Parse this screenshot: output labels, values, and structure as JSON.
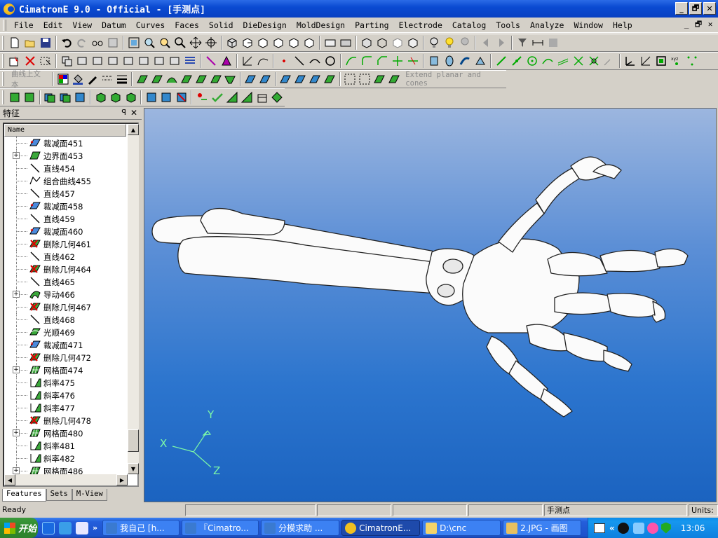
{
  "window": {
    "title": "CimatronE 9.0 - Official - [手测点]",
    "min": "_",
    "max": "🗗",
    "close": "✕"
  },
  "menu": [
    "File",
    "Edit",
    "View",
    "Datum",
    "Curves",
    "Faces",
    "Solid",
    "DieDesign",
    "MoldDesign",
    "Parting",
    "Electrode",
    "Catalog",
    "Tools",
    "Analyze",
    "Window",
    "Help"
  ],
  "toolbar3": {
    "disabled_text_1": "曲线上文本",
    "disabled_text_2": "Extend planar and cones"
  },
  "panel": {
    "title": "特征",
    "column": "Name",
    "items": [
      {
        "label": "裁减面451",
        "icon": "trim"
      },
      {
        "label": "边界面453",
        "icon": "boundary",
        "expand": "+"
      },
      {
        "label": "直线454",
        "icon": "line"
      },
      {
        "label": "组合曲线455",
        "icon": "composite"
      },
      {
        "label": "直线457",
        "icon": "line"
      },
      {
        "label": "裁减面458",
        "icon": "trim"
      },
      {
        "label": "直线459",
        "icon": "line"
      },
      {
        "label": "裁减面460",
        "icon": "trim"
      },
      {
        "label": "删除几何461",
        "icon": "delete"
      },
      {
        "label": "直线462",
        "icon": "line"
      },
      {
        "label": "删除几何464",
        "icon": "delete"
      },
      {
        "label": "直线465",
        "icon": "line"
      },
      {
        "label": "导动466",
        "icon": "sweep",
        "expand": "+"
      },
      {
        "label": "删除几何467",
        "icon": "delete"
      },
      {
        "label": "直线468",
        "icon": "line"
      },
      {
        "label": "光顺469",
        "icon": "smooth"
      },
      {
        "label": "裁减面471",
        "icon": "trim"
      },
      {
        "label": "删除几何472",
        "icon": "delete"
      },
      {
        "label": "网格面474",
        "icon": "mesh",
        "expand": "+"
      },
      {
        "label": "斜率475",
        "icon": "slope"
      },
      {
        "label": "斜率476",
        "icon": "slope"
      },
      {
        "label": "斜率477",
        "icon": "slope"
      },
      {
        "label": "删除几何478",
        "icon": "delete"
      },
      {
        "label": "网格面480",
        "icon": "mesh",
        "expand": "+"
      },
      {
        "label": "斜率481",
        "icon": "slope"
      },
      {
        "label": "斜率482",
        "icon": "slope"
      },
      {
        "label": "网格面486",
        "icon": "mesh",
        "expand": "+"
      }
    ],
    "tabs": [
      "Features",
      "Sets",
      "M-View"
    ]
  },
  "axes": {
    "x": "X",
    "y": "Y",
    "z": "Z"
  },
  "status": {
    "ready": "Ready",
    "model": "手测点",
    "units": "Units:"
  },
  "taskbar": {
    "start": "开始",
    "more": "»",
    "tasks": [
      "我自己 [h...",
      "『Cimatro...",
      "分模求助 ...",
      "CimatronE...",
      "D:\\cnc",
      "2.JPG - 画图"
    ],
    "clock": "13:06",
    "tray_more": "«"
  },
  "colors": {
    "accent": "#0a4ad2",
    "viewport_top": "#9cb6df",
    "viewport_bottom": "#1b63c0",
    "axis": "#7cf8a8"
  }
}
